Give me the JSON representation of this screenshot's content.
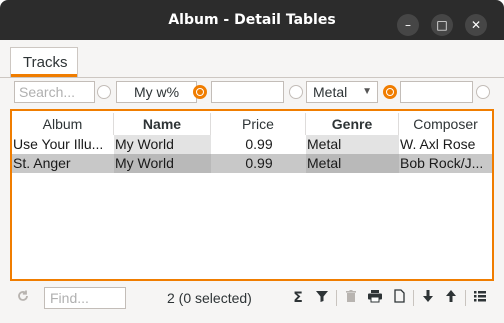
{
  "window": {
    "title": "Album - Detail Tables",
    "controls": {
      "minimize": "–",
      "maximize": "□",
      "close": "✕"
    }
  },
  "tabs": [
    {
      "label": "Tracks"
    }
  ],
  "filters": {
    "search_placeholder": "Search...",
    "name_filter_value": "My w%",
    "price_filter_value": "",
    "genre_select_value": "Metal",
    "composer_filter_value": ""
  },
  "table": {
    "columns": [
      "Album",
      "Name",
      "Price",
      "Genre",
      "Composer"
    ],
    "rows": [
      [
        "Use Your Illu...",
        "My World",
        "0.99",
        "Metal",
        "W. Axl Rose"
      ],
      [
        "St. Anger",
        "My World",
        "0.99",
        "Metal",
        "Bob Rock/J..."
      ]
    ]
  },
  "statusbar": {
    "find_placeholder": "Find...",
    "record_count": "2 (0 selected)",
    "icons": [
      "refresh-icon",
      "sum-icon",
      "filter-icon",
      "delete-icon",
      "print-icon",
      "copy-icon",
      "arrow-down-icon",
      "arrow-up-icon",
      "list-icon"
    ]
  },
  "colors": {
    "accent": "#f07d00",
    "titlebar": "#2c2c2c",
    "selected_row": "#c8c8c8"
  }
}
